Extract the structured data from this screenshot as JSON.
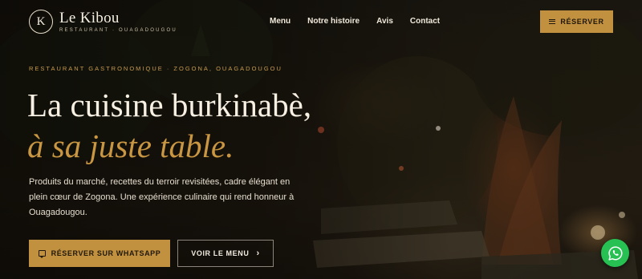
{
  "brand": {
    "mark": "K",
    "name": "Le Kibou",
    "subtitle": "RESTAURANT · OUAGADOUGOU"
  },
  "nav": {
    "items": [
      {
        "label": "Menu"
      },
      {
        "label": "Notre histoire"
      },
      {
        "label": "Avis"
      },
      {
        "label": "Contact"
      }
    ]
  },
  "header": {
    "reserve_label": "RÉSERVER",
    "reserve_icon": "menu-icon"
  },
  "hero": {
    "eyebrow": "RESTAURANT GASTRONOMIQUE · ZOGONA, OUAGADOUGOU",
    "headline_line1": "La cuisine burkinabè,",
    "headline_line2": "à sa juste table.",
    "lead": "Produits du marché, recettes du terroir revisitées, cadre élégant en plein cœur de Zogona. Une expérience culinaire qui rend honneur à Ouagadougou.",
    "cta_primary_label": "RÉSERVER SUR WHATSAPP",
    "cta_primary_icon": "chat-icon",
    "cta_secondary_label": "VOIR LE MENU",
    "cta_secondary_icon": "chevron-right-icon"
  },
  "floating": {
    "whatsapp_icon": "whatsapp-icon"
  },
  "colors": {
    "accent": "#c2913f",
    "accent_text": "#c99642",
    "whatsapp": "#26c152",
    "background": "#1a1710"
  }
}
